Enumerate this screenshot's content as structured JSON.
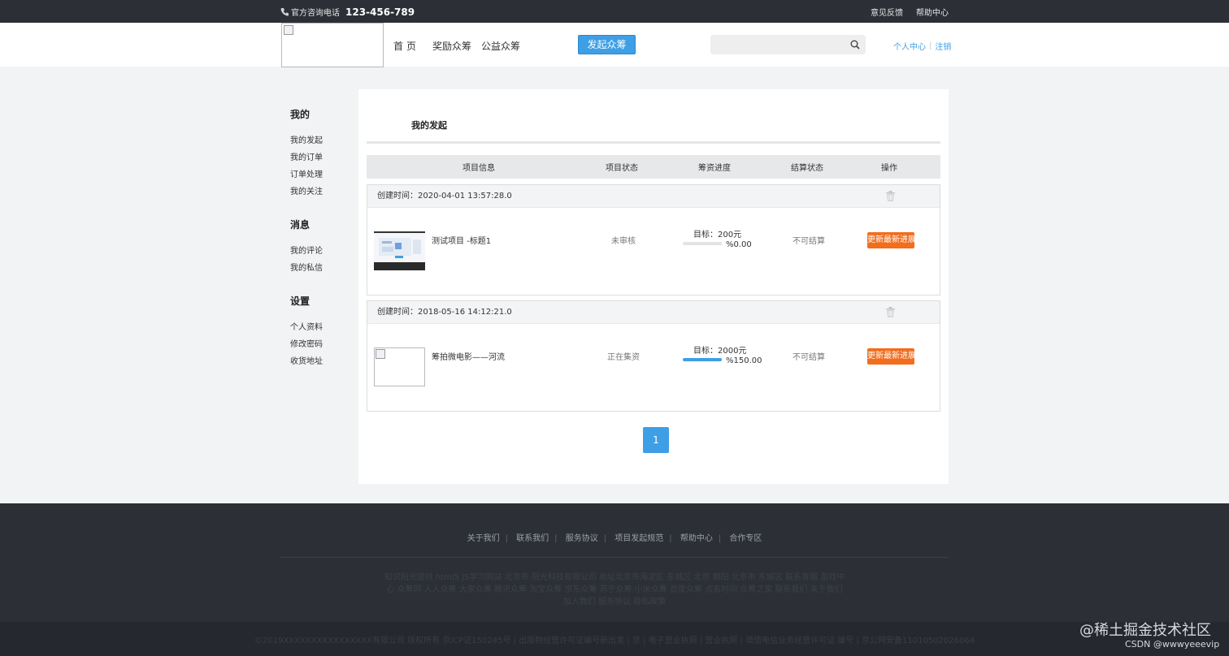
{
  "topbar": {
    "phone_label": "官方咨询电话",
    "phone_number": "123-456-789",
    "links": [
      "意见反馈",
      "帮助中心"
    ]
  },
  "header": {
    "nav": [
      "首页",
      "奖励众筹",
      "公益众筹"
    ],
    "launch_button": "发起众筹",
    "search_placeholder": "",
    "user_center": "个人中心",
    "logout": "注销"
  },
  "sidebar": {
    "groups": [
      {
        "title": "我的",
        "items": [
          "我的发起",
          "我的订单",
          "订单处理",
          "我的关注"
        ]
      },
      {
        "title": "消息",
        "items": [
          "我的评论",
          "我的私信"
        ]
      },
      {
        "title": "设置",
        "items": [
          "个人资料",
          "修改密码",
          "收货地址"
        ]
      }
    ]
  },
  "main": {
    "title": "我的发起",
    "columns": [
      "项目信息",
      "项目状态",
      "筹资进度",
      "结算状态",
      "操作"
    ],
    "projects": [
      {
        "created": "创建时间：2020-04-01 13:57:28.0",
        "name": "测试项目 -标题1",
        "status": "未审核",
        "target": "目标：200元",
        "progress_text": "%0.00",
        "progress": 0.0,
        "settlement": "不可结算",
        "action": "更新最新进展"
      },
      {
        "created": "创建时间：2018-05-16 14:12:21.0",
        "name": "筹拍微电影——河流",
        "status": "正在集资",
        "target": "目标：2000元",
        "progress_text": "%150.00",
        "progress": 1.5,
        "settlement": "不可结算",
        "action": "更新最新进展"
      }
    ],
    "page": "1"
  },
  "footer": {
    "links": [
      "关于我们",
      "联系我们",
      "服务协议",
      "项目发起规范",
      "帮助中心",
      "合作专区"
    ],
    "description": "知识阳光提供 html5 JS学习网站 北京市 阳光科技有限公司 地址北京市海淀区 东城区 北京 朝阳 北京市 东城区 联系客服 游戏中心 众筹网 人人众筹 大家众筹 腾讯众筹 淘宝众筹 京东众筹 苏宁众筹 小米众筹 百度众筹 点名时间 众筹之家 联系我们 关于我们 加入我们 服务协议 隐私政策",
    "copyright": "©2019XXXXXXXXXXXXXXXX有限公司 版权所有 京ICP证150245号 | 出版物经营许可证编号新出发 | 京 | 电子营业执照 | 营业执照 | 增值电信业务经营许可证 编号 | 京公网安备11010502026064"
  },
  "watermark": {
    "line1": "@稀土掘金技术社区",
    "line2": "CSDN @wwwyeeevip"
  }
}
